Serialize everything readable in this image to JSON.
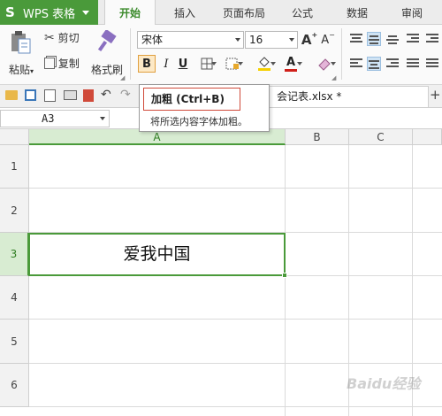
{
  "app": {
    "name": "WPS 表格"
  },
  "menu": {
    "tabs": [
      "开始",
      "插入",
      "页面布局",
      "公式",
      "数据",
      "审阅"
    ],
    "active_tab": "开始"
  },
  "ribbon": {
    "paste": "粘贴",
    "cut": "剪切",
    "copy": "复制",
    "format_painter": "格式刷",
    "font_name": "宋体",
    "font_size": "16",
    "grow_font": "A",
    "shrink_font": "A",
    "bold": "B",
    "italic": "I",
    "underline": "U",
    "font_color_glyph": "A"
  },
  "file_tab": {
    "name": "会记表.xlsx *"
  },
  "new_tab": "+",
  "formula_bar": {
    "cell_ref": "A3"
  },
  "grid": {
    "columns": [
      "A",
      "B",
      "C"
    ],
    "rows": [
      "1",
      "2",
      "3",
      "4",
      "5",
      "6"
    ],
    "selected_cell": {
      "value": "爱我中国"
    }
  },
  "tooltip": {
    "title": "加粗 (Ctrl+B)",
    "description": "将所选内容字体加粗。"
  },
  "watermark": "Baidu经验",
  "colors": {
    "accent_green": "#4a9a3a",
    "font_color_red": "#d0201a",
    "highlight_yellow": "#f5d000"
  }
}
